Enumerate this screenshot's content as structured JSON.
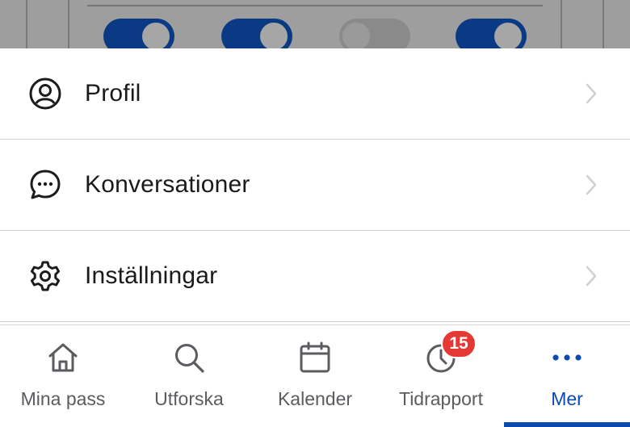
{
  "menu": {
    "items": [
      {
        "label": "Profil",
        "icon": "profile-icon"
      },
      {
        "label": "Konversationer",
        "icon": "chat-icon"
      },
      {
        "label": "Inställningar",
        "icon": "gear-icon"
      }
    ]
  },
  "backdrop": {
    "toggles": [
      true,
      true,
      false,
      true
    ]
  },
  "tabbar": {
    "tabs": [
      {
        "label": "Mina pass",
        "icon": "home-icon"
      },
      {
        "label": "Utforska",
        "icon": "search-icon"
      },
      {
        "label": "Kalender",
        "icon": "calendar-icon"
      },
      {
        "label": "Tidrapport",
        "icon": "clock-icon",
        "badge": "15"
      },
      {
        "label": "Mer",
        "icon": "more-icon",
        "active": true
      }
    ]
  },
  "colors": {
    "accent": "#0b4bb0",
    "badge": "#e53935",
    "toggle_on": "#0b3a85"
  }
}
